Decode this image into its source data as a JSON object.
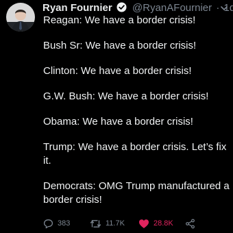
{
  "author": {
    "name": "Ryan Fournier",
    "handle": "@RyanAFournier",
    "separator": "·",
    "time": "1d"
  },
  "icons": {
    "avatar": "avatar-photo",
    "verified": "verified-badge-icon",
    "menu": "chevron-down-icon",
    "reply": "reply-icon",
    "retweet": "retweet-icon",
    "like": "heart-icon",
    "share": "share-icon"
  },
  "tweet": {
    "lines": [
      "Reagan: We have a border crisis!",
      "Bush Sr: We have a border crisis!",
      "Clinton: We have a border crisis!",
      "G.W. Bush: We have a border crisis!",
      "Obama: We have a border crisis!",
      "Trump: We have a border crisis. Let’s fix it.",
      "Democrats: OMG Trump manufactured a border crisis!"
    ]
  },
  "stats": {
    "replies": "383",
    "retweets": "11.7K",
    "likes": "28.8K"
  },
  "colors": {
    "background": "#000000",
    "text": "#e7e9ea",
    "muted": "#7c8590",
    "verified": "#1da1f2",
    "like": "#e0245e"
  }
}
